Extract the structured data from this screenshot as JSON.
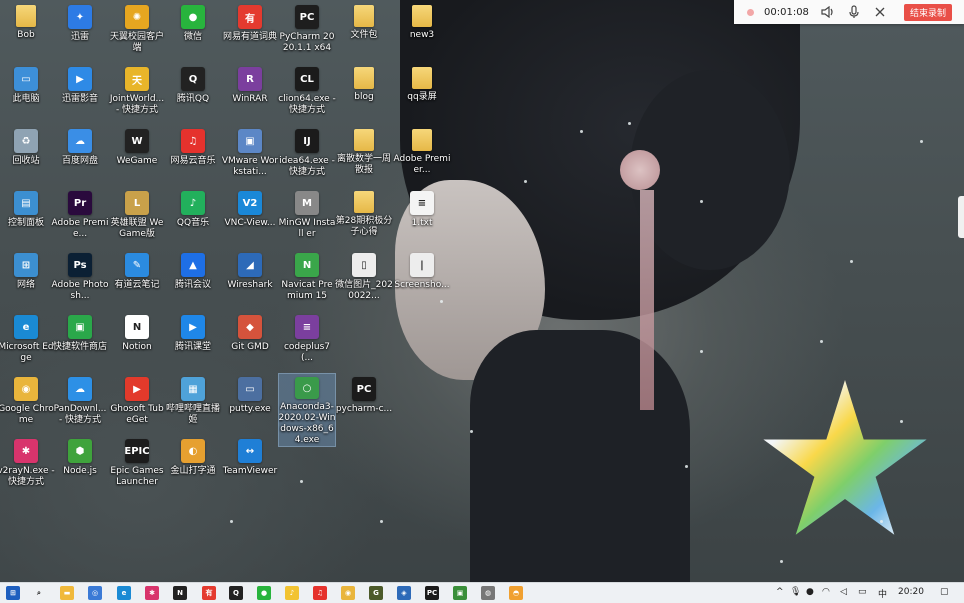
{
  "recorder": {
    "time": "00:01:08",
    "stop_label": "结束录制"
  },
  "desktop": {
    "icons": [
      {
        "label": "Bob",
        "kind": "folder"
      },
      {
        "label": "迅雷",
        "color": "#2d7be5",
        "glyph": "✦"
      },
      {
        "label": "天翼校园客户端",
        "color": "#e6a620",
        "glyph": "✺"
      },
      {
        "label": "微信",
        "color": "#28b43d",
        "glyph": "●"
      },
      {
        "label": "网易有道词典",
        "color": "#e43a2f",
        "glyph": "有"
      },
      {
        "label": "PyCharm 2020.1.1 x64",
        "color": "#1e1e1e",
        "glyph": "PC"
      },
      {
        "label": "文件包",
        "kind": "folder"
      },
      {
        "label": "new3",
        "kind": "folder"
      },
      {
        "label": "此电脑",
        "color": "#3d8fd8",
        "glyph": "▭"
      },
      {
        "label": "迅雷影音",
        "color": "#2e8ae6",
        "glyph": "▶"
      },
      {
        "label": "JointWorld... - 快捷方式",
        "color": "#e8b52a",
        "glyph": "天"
      },
      {
        "label": "腾讯QQ",
        "color": "#222",
        "glyph": "Q"
      },
      {
        "label": "WinRAR",
        "color": "#7b3f9e",
        "glyph": "R"
      },
      {
        "label": "clion64.exe - 快捷方式",
        "color": "#1b1b1b",
        "glyph": "CL"
      },
      {
        "label": "blog",
        "kind": "folder"
      },
      {
        "label": "qq录屏",
        "kind": "folder"
      },
      {
        "label": "回收站",
        "color": "#8fa3b3",
        "glyph": "♻"
      },
      {
        "label": "百度网盘",
        "color": "#3a8ee6",
        "glyph": "☁"
      },
      {
        "label": "WeGame",
        "color": "#222",
        "glyph": "W"
      },
      {
        "label": "网易云音乐",
        "color": "#e5322d",
        "glyph": "♫"
      },
      {
        "label": "VMware Workstati...",
        "color": "#5c87c6",
        "glyph": "▣"
      },
      {
        "label": "idea64.exe - 快捷方式",
        "color": "#1b1b1b",
        "glyph": "IJ"
      },
      {
        "label": "离散数学一周散报",
        "kind": "folder"
      },
      {
        "label": "Adobe Premier...",
        "kind": "folder"
      },
      {
        "label": "控制面板",
        "color": "#3c8fd1",
        "glyph": "▤"
      },
      {
        "label": "Adobe Premie...",
        "color": "#2a0a3d",
        "glyph": "Pr"
      },
      {
        "label": "英雄联盟 WeGame版",
        "color": "#c9a14a",
        "glyph": "L"
      },
      {
        "label": "QQ音乐",
        "color": "#22b05c",
        "glyph": "♪"
      },
      {
        "label": "VNC-View...",
        "color": "#1a88d8",
        "glyph": "V2"
      },
      {
        "label": "MinGW Install er",
        "color": "#888",
        "glyph": "M"
      },
      {
        "label": "第28期积极分子心得",
        "kind": "folder"
      },
      {
        "label": "1.txt",
        "color": "#f4f4f4",
        "glyph": "≡"
      },
      {
        "label": "网络",
        "color": "#3c8fd1",
        "glyph": "⊞"
      },
      {
        "label": "Adobe Photosh...",
        "color": "#0b2034",
        "glyph": "Ps"
      },
      {
        "label": "有道云笔记",
        "color": "#2b8be0",
        "glyph": "✎"
      },
      {
        "label": "腾讯会议",
        "color": "#1e6fe6",
        "glyph": "▲"
      },
      {
        "label": "Wireshark",
        "color": "#2d6ab8",
        "glyph": "◢"
      },
      {
        "label": "Navicat Premium 15",
        "color": "#3aa64a",
        "glyph": "N"
      },
      {
        "label": "微信图片_2020022...",
        "color": "#ededed",
        "glyph": "▯"
      },
      {
        "label": "Screensho...",
        "color": "#ededed",
        "glyph": "|"
      },
      {
        "label": "Microsoft Edge",
        "color": "#1a8ad4",
        "glyph": "e"
      },
      {
        "label": "快捷软件商店",
        "color": "#2aa84a",
        "glyph": "▣"
      },
      {
        "label": "Notion",
        "color": "#fff",
        "glyph": "N"
      },
      {
        "label": "腾讯课堂",
        "color": "#1f87e8",
        "glyph": "▶"
      },
      {
        "label": "Git GMD",
        "color": "#d5533c",
        "glyph": "◆"
      },
      {
        "label": "codeplus7(...",
        "color": "#7b3f9e",
        "glyph": "≡"
      },
      {
        "label": "",
        "kind": "none"
      },
      {
        "label": "",
        "kind": "none"
      },
      {
        "label": "Google Chrome",
        "color": "#e9b53c",
        "glyph": "◉"
      },
      {
        "label": "PanDownl... - 快捷方式",
        "color": "#2d90e6",
        "glyph": "☁"
      },
      {
        "label": "Ghosoft TubeGet",
        "color": "#e23a2b",
        "glyph": "▶"
      },
      {
        "label": "哔哩哔哩直播姬",
        "color": "#4fa2d9",
        "glyph": "▦"
      },
      {
        "label": "putty.exe",
        "color": "#4c6fa0",
        "glyph": "▭"
      },
      {
        "label": "Anaconda3-2020.02-Windows-x86_64.exe",
        "color": "#3a9a4a",
        "glyph": "○",
        "selected": true
      },
      {
        "label": "pycharm-c...",
        "color": "#1b1b1b",
        "glyph": "PC"
      },
      {
        "label": "",
        "kind": "none"
      },
      {
        "label": "v2rayN.exe - 快捷方式",
        "color": "#d8346c",
        "glyph": "✱"
      },
      {
        "label": "Node.js",
        "color": "#3fa33c",
        "glyph": "⬢"
      },
      {
        "label": "Epic Games Launcher",
        "color": "#1c1c1c",
        "glyph": "EPIC"
      },
      {
        "label": "金山打字通",
        "color": "#e6a030",
        "glyph": "◐"
      },
      {
        "label": "TeamViewer",
        "color": "#1f7fd6",
        "glyph": "↔"
      }
    ]
  },
  "taskbar": {
    "items": [
      {
        "name": "windows-start-icon",
        "color": "#1e5fbf",
        "glyph": "⊞"
      },
      {
        "name": "search-icon",
        "color": "#eef1f4",
        "glyph": "⌕"
      },
      {
        "name": "file-explorer-icon",
        "color": "#f0b93b",
        "glyph": "▬"
      },
      {
        "name": "compass-icon",
        "color": "#3a7ad6",
        "glyph": "◎"
      },
      {
        "name": "edge-icon",
        "color": "#1a8ad4",
        "glyph": "e"
      },
      {
        "name": "colorful-app-icon",
        "color": "#d8346c",
        "glyph": "✱"
      },
      {
        "name": "notion-icon",
        "color": "#222",
        "glyph": "N"
      },
      {
        "name": "youdao-icon",
        "color": "#e43a2f",
        "glyph": "有"
      },
      {
        "name": "qq-icon",
        "color": "#222",
        "glyph": "Q"
      },
      {
        "name": "wechat-icon",
        "color": "#28b43d",
        "glyph": "●"
      },
      {
        "name": "qq-music-icon",
        "color": "#f2c331",
        "glyph": "♪"
      },
      {
        "name": "netease-music-icon",
        "color": "#e5322d",
        "glyph": "♫"
      },
      {
        "name": "chrome-icon",
        "color": "#e9b53c",
        "glyph": "◉"
      },
      {
        "name": "app-icon",
        "color": "#4c5a2a",
        "glyph": "G"
      },
      {
        "name": "app-icon-2",
        "color": "#2d6ab8",
        "glyph": "◈"
      },
      {
        "name": "pycharm-icon",
        "color": "#1b1b1b",
        "glyph": "PC"
      },
      {
        "name": "app-icon-3",
        "color": "#3a8f3a",
        "glyph": "▣"
      },
      {
        "name": "app-icon-4",
        "color": "#777",
        "glyph": "◍"
      },
      {
        "name": "app-icon-5",
        "color": "#f0a030",
        "glyph": "◓"
      }
    ],
    "tray": {
      "chevron": "^",
      "ime": "中",
      "clock": "20:20"
    }
  }
}
